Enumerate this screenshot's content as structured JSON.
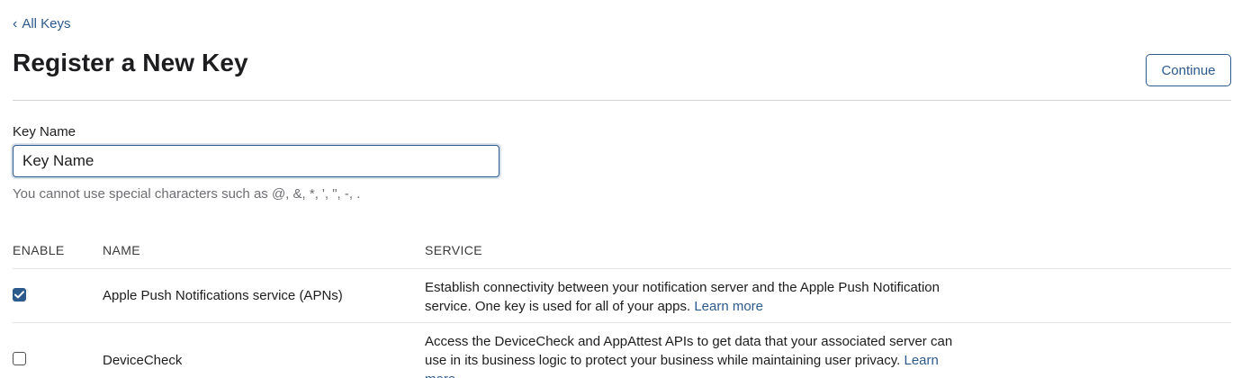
{
  "header": {
    "back_label": "All Keys",
    "title": "Register a New Key",
    "continue_label": "Continue"
  },
  "form": {
    "key_name_label": "Key Name",
    "key_name_placeholder": "Key Name",
    "key_name_value": "",
    "hint": "You cannot use special characters such as @, &, *, ', \", -, ."
  },
  "table": {
    "columns": [
      "ENABLE",
      "NAME",
      "SERVICE"
    ],
    "rows": [
      {
        "enabled": true,
        "name": "Apple Push Notifications service (APNs)",
        "description": "Establish connectivity between your notification server and the Apple Push Notification service. One key is used for all of your apps.",
        "link": "Learn more"
      },
      {
        "enabled": false,
        "name": "DeviceCheck",
        "description": "Access the DeviceCheck and AppAttest APIs to get data that your associated server can use in its business logic to protect your business while maintaining user privacy.",
        "link": "Learn more"
      }
    ]
  },
  "colors": {
    "link": "#2d5a8c",
    "text": "#1d1d1f",
    "hint": "#6e6e73",
    "divider": "#d2d2d7"
  },
  "icons": {
    "back": "chevron-left-icon",
    "check": "checkmark-icon"
  }
}
